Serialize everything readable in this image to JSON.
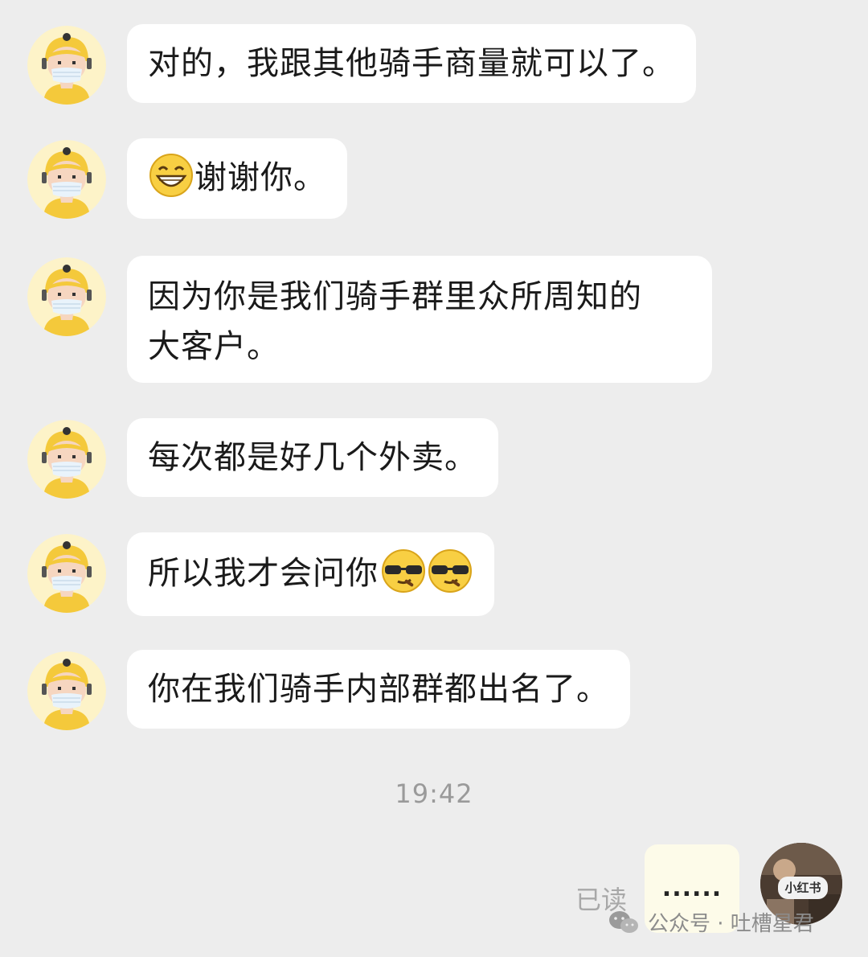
{
  "messages": [
    {
      "sender": "rider",
      "lines": [
        "对的，我跟其他骑手商量就可以了。"
      ]
    },
    {
      "sender": "rider",
      "prefix_emoji": "grin-emoji",
      "lines": [
        "谢谢你。"
      ]
    },
    {
      "sender": "rider",
      "lines": [
        "因为你是我们骑手群里众所周知的",
        "大客户。"
      ]
    },
    {
      "sender": "rider",
      "lines": [
        "每次都是好几个外卖。"
      ]
    },
    {
      "sender": "rider",
      "suffix_emoji": [
        "smug-sunglasses-emoji",
        "smug-sunglasses-emoji"
      ],
      "lines": [
        "所以我才会问你"
      ]
    },
    {
      "sender": "rider",
      "lines": [
        "你在我们骑手内部群都出名了。"
      ]
    }
  ],
  "timestamp": "19:42",
  "my_message": {
    "text": "......",
    "read_status": "已读"
  },
  "my_avatar": {
    "label": "小红书"
  },
  "watermark": {
    "icon": "wechat-icon",
    "text": "公众号 · 吐槽星君"
  },
  "colors": {
    "background": "#ededed",
    "bubble": "#ffffff",
    "my_bubble": "#fdfbe9",
    "avatar_yellow": "#f4c93b"
  }
}
